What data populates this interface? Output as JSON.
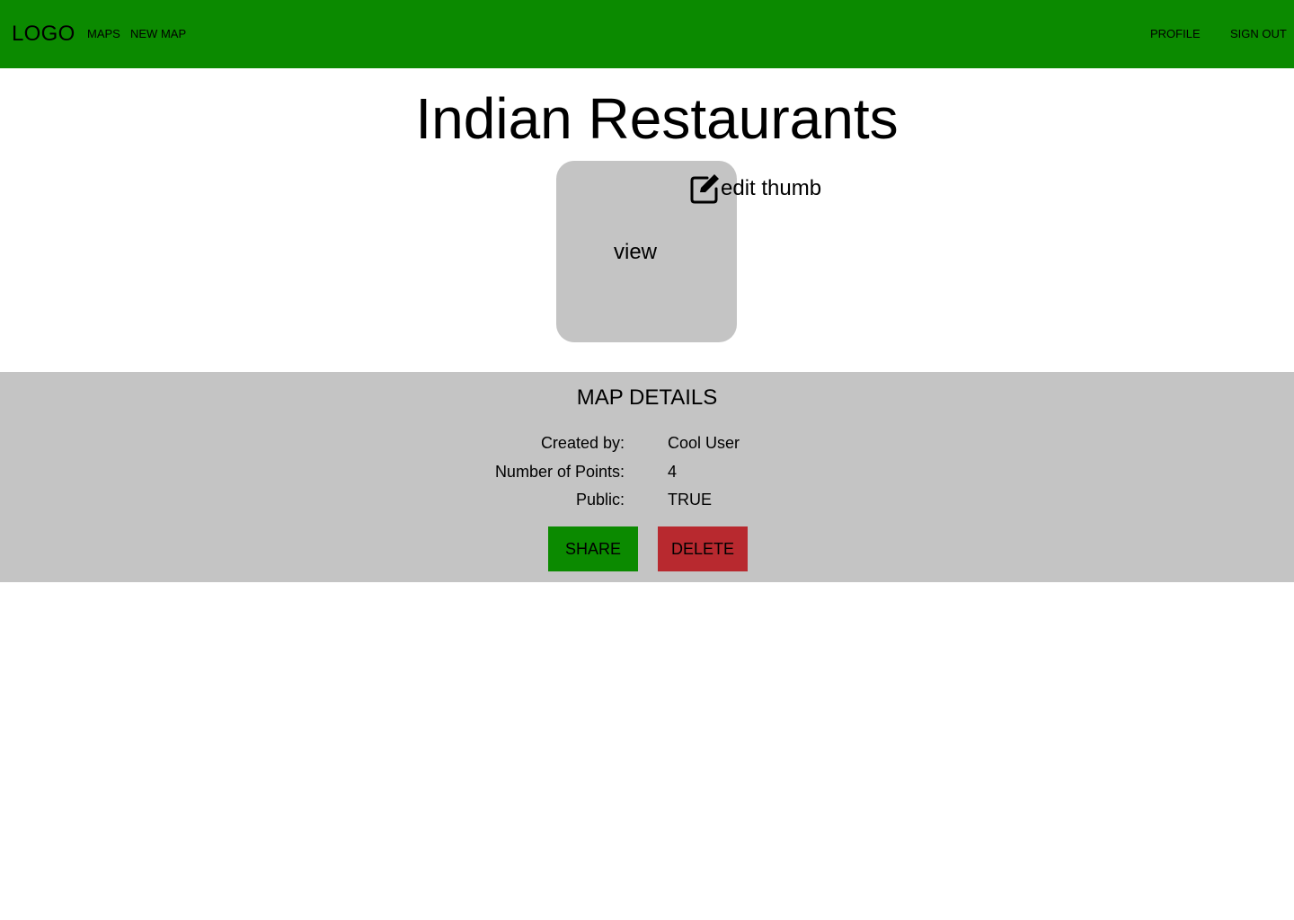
{
  "colors": {
    "navbar": "#0b8a00",
    "panel": "#c4c4c4",
    "share": "#0b8a00",
    "delete": "#b8292f"
  },
  "navbar": {
    "logo": "LOGO",
    "links": {
      "maps": "MAPS",
      "new_map": "NEW MAP",
      "profile": "PROFILE",
      "sign_out": "SIGN OUT"
    }
  },
  "page": {
    "title": "Indian Restaurants"
  },
  "thumbnail": {
    "view_label": "view",
    "edit_label": "edit thumb",
    "edit_icon": "edit-square-icon"
  },
  "details": {
    "title": "MAP DETAILS",
    "created_by": {
      "label": "Created by:",
      "value": "Cool User"
    },
    "num_points": {
      "label": "Number of Points:",
      "value": "4"
    },
    "public": {
      "label": "Public:",
      "value": "TRUE"
    }
  },
  "actions": {
    "share": "SHARE",
    "delete": "DELETE"
  }
}
